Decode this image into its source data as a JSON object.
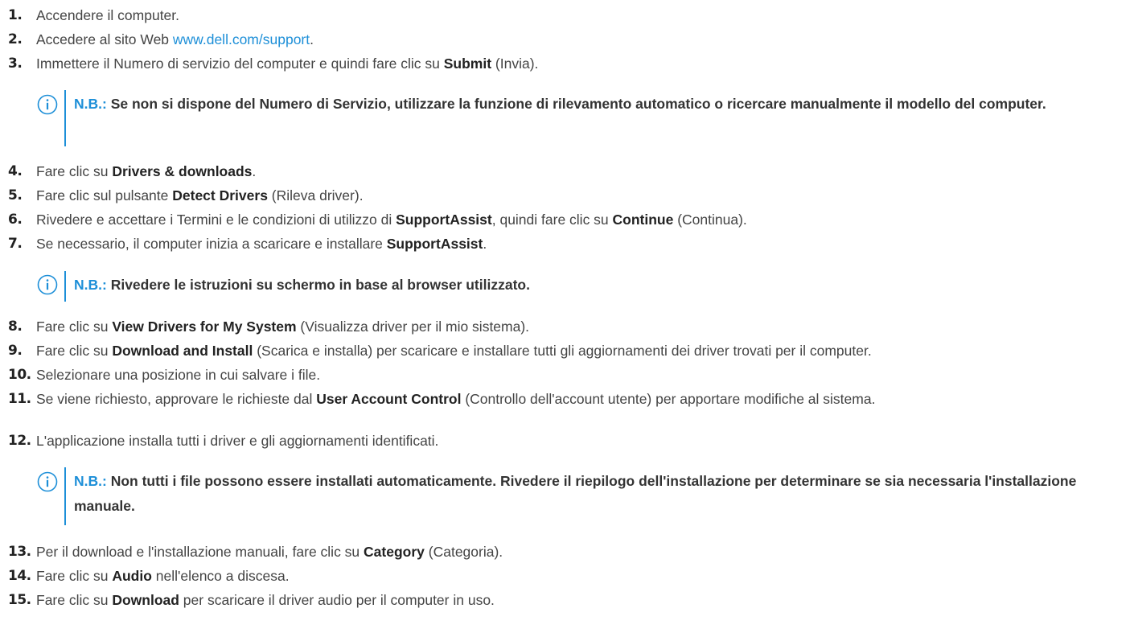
{
  "steps": [
    {
      "num": "1.",
      "parts": [
        {
          "t": "Accendere il computer."
        }
      ]
    },
    {
      "num": "2.",
      "parts": [
        {
          "t": "Accedere al sito Web "
        },
        {
          "t": "www.dell.com/support",
          "link": true
        },
        {
          "t": "."
        }
      ]
    },
    {
      "num": "3.",
      "parts": [
        {
          "t": "Immettere il Numero di servizio del computer e quindi fare clic su "
        },
        {
          "t": "Submit",
          "b": true
        },
        {
          "t": " (Invia)."
        }
      ]
    },
    {
      "num": "4.",
      "parts": [
        {
          "t": "Fare clic su "
        },
        {
          "t": "Drivers & downloads",
          "b": true
        },
        {
          "t": "."
        }
      ]
    },
    {
      "num": "5.",
      "parts": [
        {
          "t": "Fare clic sul pulsante "
        },
        {
          "t": "Detect Drivers",
          "b": true
        },
        {
          "t": " (Rileva driver)."
        }
      ]
    },
    {
      "num": "6.",
      "parts": [
        {
          "t": "Rivedere e accettare i Termini e le condizioni di utilizzo di "
        },
        {
          "t": "SupportAssist",
          "b": true
        },
        {
          "t": ", quindi fare clic su "
        },
        {
          "t": "Continue",
          "b": true
        },
        {
          "t": " (Continua)."
        }
      ]
    },
    {
      "num": "7.",
      "parts": [
        {
          "t": "Se necessario, il computer inizia a scaricare e installare "
        },
        {
          "t": "SupportAssist",
          "b": true
        },
        {
          "t": "."
        }
      ]
    },
    {
      "num": "8.",
      "parts": [
        {
          "t": "Fare clic su "
        },
        {
          "t": "View Drivers for My System",
          "b": true
        },
        {
          "t": " (Visualizza driver per il mio sistema)."
        }
      ]
    },
    {
      "num": "9.",
      "parts": [
        {
          "t": "Fare clic su "
        },
        {
          "t": "Download and Install",
          "b": true
        },
        {
          "t": " (Scarica e installa) per scaricare e installare tutti gli aggiornamenti dei driver trovati per il computer."
        }
      ]
    },
    {
      "num": "10.",
      "parts": [
        {
          "t": "Selezionare una posizione in cui salvare i file."
        }
      ]
    },
    {
      "num": "11.",
      "parts": [
        {
          "t": "Se viene richiesto, approvare le richieste dal "
        },
        {
          "t": "User Account Control",
          "b": true
        },
        {
          "t": " (Controllo dell'account utente) per apportare modifiche al sistema."
        }
      ]
    },
    {
      "num": "12.",
      "parts": [
        {
          "t": "L'applicazione installa tutti i driver e gli aggiornamenti identificati."
        }
      ]
    },
    {
      "num": "13.",
      "parts": [
        {
          "t": "Per il download e l'installazione manuali, fare clic su "
        },
        {
          "t": "Category",
          "b": true
        },
        {
          "t": " (Categoria)."
        }
      ]
    },
    {
      "num": "14.",
      "parts": [
        {
          "t": "Fare clic su "
        },
        {
          "t": "Audio",
          "b": true
        },
        {
          "t": " nell'elenco a discesa."
        }
      ]
    },
    {
      "num": "15.",
      "parts": [
        {
          "t": "Fare clic su "
        },
        {
          "t": "Download",
          "b": true
        },
        {
          "t": " per scaricare il driver audio per il computer in uso."
        }
      ]
    }
  ],
  "notes": [
    {
      "label": "N.B.:",
      "text": "Se non si dispone del Numero di Servizio, utilizzare la funzione di rilevamento automatico o ricercare manualmente il modello del computer."
    },
    {
      "label": "N.B.:",
      "text": "Rivedere le istruzioni su schermo in base al browser utilizzato."
    },
    {
      "label": "N.B.:",
      "text": "Non tutti i file possono essere installati automaticamente. Rivedere il riepilogo dell'installazione per determinare se sia necessaria l'installazione manuale."
    }
  ],
  "icons": {
    "note": "info-icon"
  },
  "colors": {
    "accent": "#1d8fd8",
    "text": "#444444",
    "heading": "#222222"
  }
}
